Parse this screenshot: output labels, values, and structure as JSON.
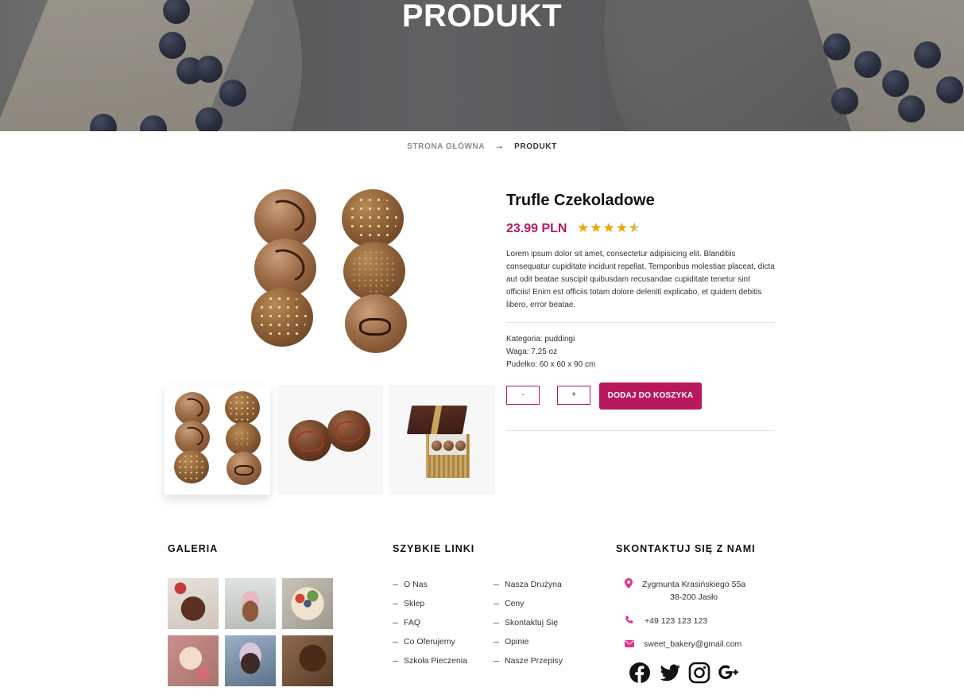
{
  "hero": {
    "title": "PRODUKT"
  },
  "breadcrumb": {
    "home": "STRONA GŁÓWNA",
    "separator": "→",
    "current": "PRODUKT"
  },
  "product": {
    "title": "Trufle Czekoladowe",
    "price": "23.99 PLN",
    "rating": 4.5,
    "rating_max": 5,
    "description": "Lorem ipsum dolor sit amet, consectetur adipisicing elit. Blanditiis consequatur cupiditate incidunt repellat. Temporibus molestiae placeat, dicta aut odit beatae suscipit quibusdam recusandae cupiditate tenetur sint officiis! Enim est officiis totam dolore deleniti explicabo, et quidem debitis libero, error beatae.",
    "meta": {
      "category": "Kategoria: puddingi",
      "weight": "Waga: 7,25 oz",
      "box": "Pudełko: 60 x 60 x 90 cm"
    },
    "qty_minus": "-",
    "qty_plus": "+",
    "add_to_cart": "DODAJ DO KOSZYKA",
    "accent_color": "#b8195e",
    "star_color": "#f0a500"
  },
  "footer": {
    "gallery": {
      "heading": "GALERIA"
    },
    "quick_links": {
      "heading": "SZYBKIE LINKI",
      "col1": [
        "O Nas",
        "Sklep",
        "FAQ",
        "Co Oferujemy",
        "Szkoła Pieczenia"
      ],
      "col2": [
        "Nasza Drużyna",
        "Ceny",
        "Skontaktuj Się",
        "Opinie",
        "Nasze Przepisy"
      ]
    },
    "contact": {
      "heading": "SKONTAKTUJ SIĘ Z NAMI",
      "address_line1": "Zygmunta Krasińskiego 55a",
      "address_line2": "38-200 Jasło",
      "phone": "+49 123 123 123",
      "email": "sweet_bakery@gmail.com",
      "icon_color": "#e0358d",
      "social": [
        "facebook-icon",
        "twitter-icon",
        "instagram-icon",
        "google-plus-icon"
      ]
    }
  }
}
